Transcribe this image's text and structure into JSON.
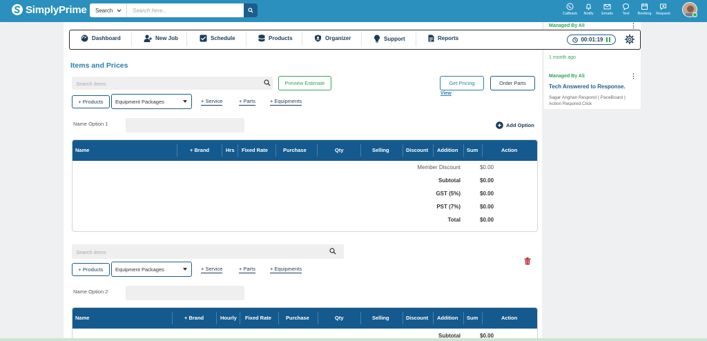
{
  "app": {
    "name": "SimplyPrime"
  },
  "topbar": {
    "search_select": "Search",
    "search_placeholder": "Search here...",
    "icons": [
      {
        "label": "Callback",
        "icon": "phone-icon"
      },
      {
        "label": "Notify",
        "icon": "bell-icon"
      },
      {
        "label": "Emails",
        "icon": "mail-icon"
      },
      {
        "label": "Text",
        "icon": "chat-icon"
      },
      {
        "label": "Booking",
        "icon": "calendar-icon"
      },
      {
        "label": "Request",
        "icon": "request-icon"
      }
    ]
  },
  "nav": {
    "items": [
      {
        "label": "Dashboard",
        "icon": "dashboard-icon"
      },
      {
        "label": "New Job",
        "icon": "user-icon"
      },
      {
        "label": "Schedule",
        "icon": "checkbox-icon"
      },
      {
        "label": "Products",
        "icon": "database-icon"
      },
      {
        "label": "Organizer",
        "icon": "shield-icon"
      },
      {
        "label": "Support",
        "icon": "bulb-icon"
      },
      {
        "label": "Reports",
        "icon": "report-icon"
      }
    ],
    "timer": "00:01:19"
  },
  "section": {
    "title": "Items and Prices"
  },
  "actions": {
    "preview_estimate": "Preview Estimate",
    "get_pricing": "Get Pricing",
    "order_parts": "Order Parts",
    "view": "View",
    "add_option": "Add Option"
  },
  "option1": {
    "search_placeholder": "Search items",
    "products_btn": "+ Products",
    "select_value": "Equipment Packages",
    "service_link": "+ Service",
    "parts_link": "+ Parts",
    "equipments_link": "+ Equipments",
    "name_label": "Name Option 1",
    "columns": [
      "Name",
      "+ Brand",
      "Hrs",
      "Fixed Rate",
      "Purchase",
      "Qty",
      "Selling",
      "Discount",
      "Addition",
      "Sum",
      "Action"
    ],
    "summary": [
      {
        "label": "Member Discount",
        "value": "$0.00"
      },
      {
        "label": "Subtotal",
        "value": "$0.00"
      },
      {
        "label": "GST (5%)",
        "value": "$0.00"
      },
      {
        "label": "PST (7%)",
        "value": "$0.00"
      },
      {
        "label": "Total",
        "value": "$0.00"
      }
    ]
  },
  "option2": {
    "search_placeholder": "Search items",
    "products_btn": "+ Products",
    "select_value": "Equipment Packages",
    "service_link": "+ Service",
    "parts_link": "+ Parts",
    "equipments_link": "+ Equipments",
    "name_label": "Name Option 2",
    "columns": [
      "Name",
      "+ Brand",
      "Hourly",
      "Fixed Rate",
      "Purchase",
      "Qty",
      "Selling",
      "Discount",
      "Addition",
      "Sum",
      "Action"
    ],
    "summary": [
      {
        "label": "Subtotal",
        "value": "$0.00"
      }
    ]
  },
  "activity": {
    "top_managed": "Managed By Ali",
    "time_ago": "1 month ago",
    "card_managed": "Managed By Ali",
    "card_title": "Tech Answered to Response.",
    "card_desc": "Sagar Anghan Respond ( PaceBoard ) Action Required Click"
  }
}
